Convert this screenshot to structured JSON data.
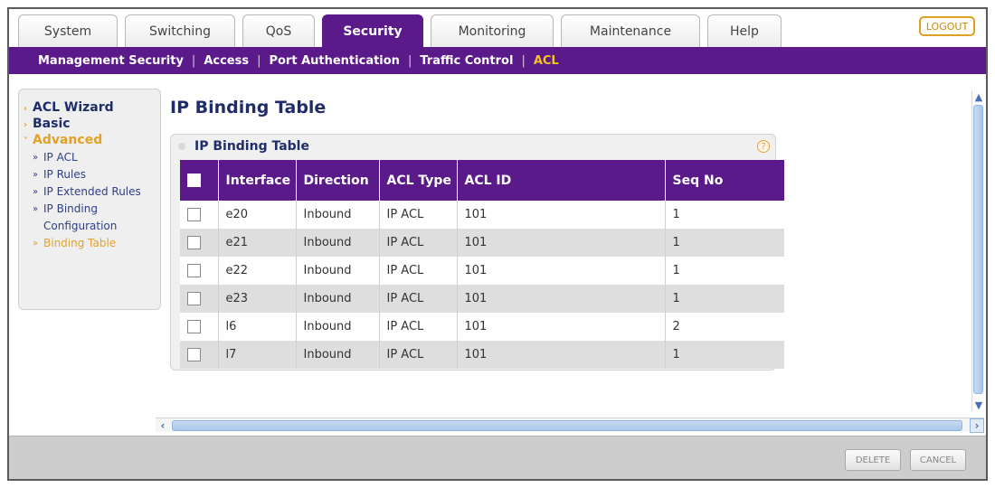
{
  "tabs": [
    {
      "label": "System",
      "active": false
    },
    {
      "label": "Switching",
      "active": false
    },
    {
      "label": "QoS",
      "active": false
    },
    {
      "label": "Security",
      "active": true
    },
    {
      "label": "Monitoring",
      "active": false
    },
    {
      "label": "Maintenance",
      "active": false
    },
    {
      "label": "Help",
      "active": false
    }
  ],
  "logout_label": "LOGOUT",
  "subnav": [
    {
      "label": "Management Security",
      "active": false
    },
    {
      "label": "Access",
      "active": false
    },
    {
      "label": "Port Authentication",
      "active": false
    },
    {
      "label": "Traffic Control",
      "active": false
    },
    {
      "label": "ACL",
      "active": true
    }
  ],
  "sidebar": {
    "items": [
      {
        "label": "ACL Wizard",
        "state": "normal"
      },
      {
        "label": "Basic",
        "state": "normal"
      },
      {
        "label": "Advanced",
        "state": "open"
      }
    ],
    "subitems": [
      {
        "label": "IP ACL",
        "active": false
      },
      {
        "label": "IP Rules",
        "active": false
      },
      {
        "label": "IP Extended Rules",
        "active": false
      },
      {
        "label": "IP Binding Configuration",
        "active": false
      },
      {
        "label": "Binding Table",
        "active": true
      }
    ]
  },
  "page_title": "IP Binding Table",
  "panel": {
    "title": "IP Binding Table",
    "help_icon": "question-icon",
    "columns": [
      "Interface",
      "Direction",
      "ACL Type",
      "ACL ID",
      "Seq No"
    ],
    "rows": [
      {
        "interface": "e20",
        "direction": "Inbound",
        "acl_type": "IP ACL",
        "acl_id": "101",
        "seq_no": "1"
      },
      {
        "interface": "e21",
        "direction": "Inbound",
        "acl_type": "IP ACL",
        "acl_id": "101",
        "seq_no": "1"
      },
      {
        "interface": "e22",
        "direction": "Inbound",
        "acl_type": "IP ACL",
        "acl_id": "101",
        "seq_no": "1"
      },
      {
        "interface": "e23",
        "direction": "Inbound",
        "acl_type": "IP ACL",
        "acl_id": "101",
        "seq_no": "1"
      },
      {
        "interface": "l6",
        "direction": "Inbound",
        "acl_type": "IP ACL",
        "acl_id": "101",
        "seq_no": "2"
      },
      {
        "interface": "l7",
        "direction": "Inbound",
        "acl_type": "IP ACL",
        "acl_id": "101",
        "seq_no": "1"
      }
    ]
  },
  "footer": {
    "delete_label": "DELETE",
    "cancel_label": "CANCEL"
  },
  "colors": {
    "accent_purple": "#5b1a8a",
    "active_orange": "#e2a228",
    "link_navy": "#1f2d6b"
  }
}
